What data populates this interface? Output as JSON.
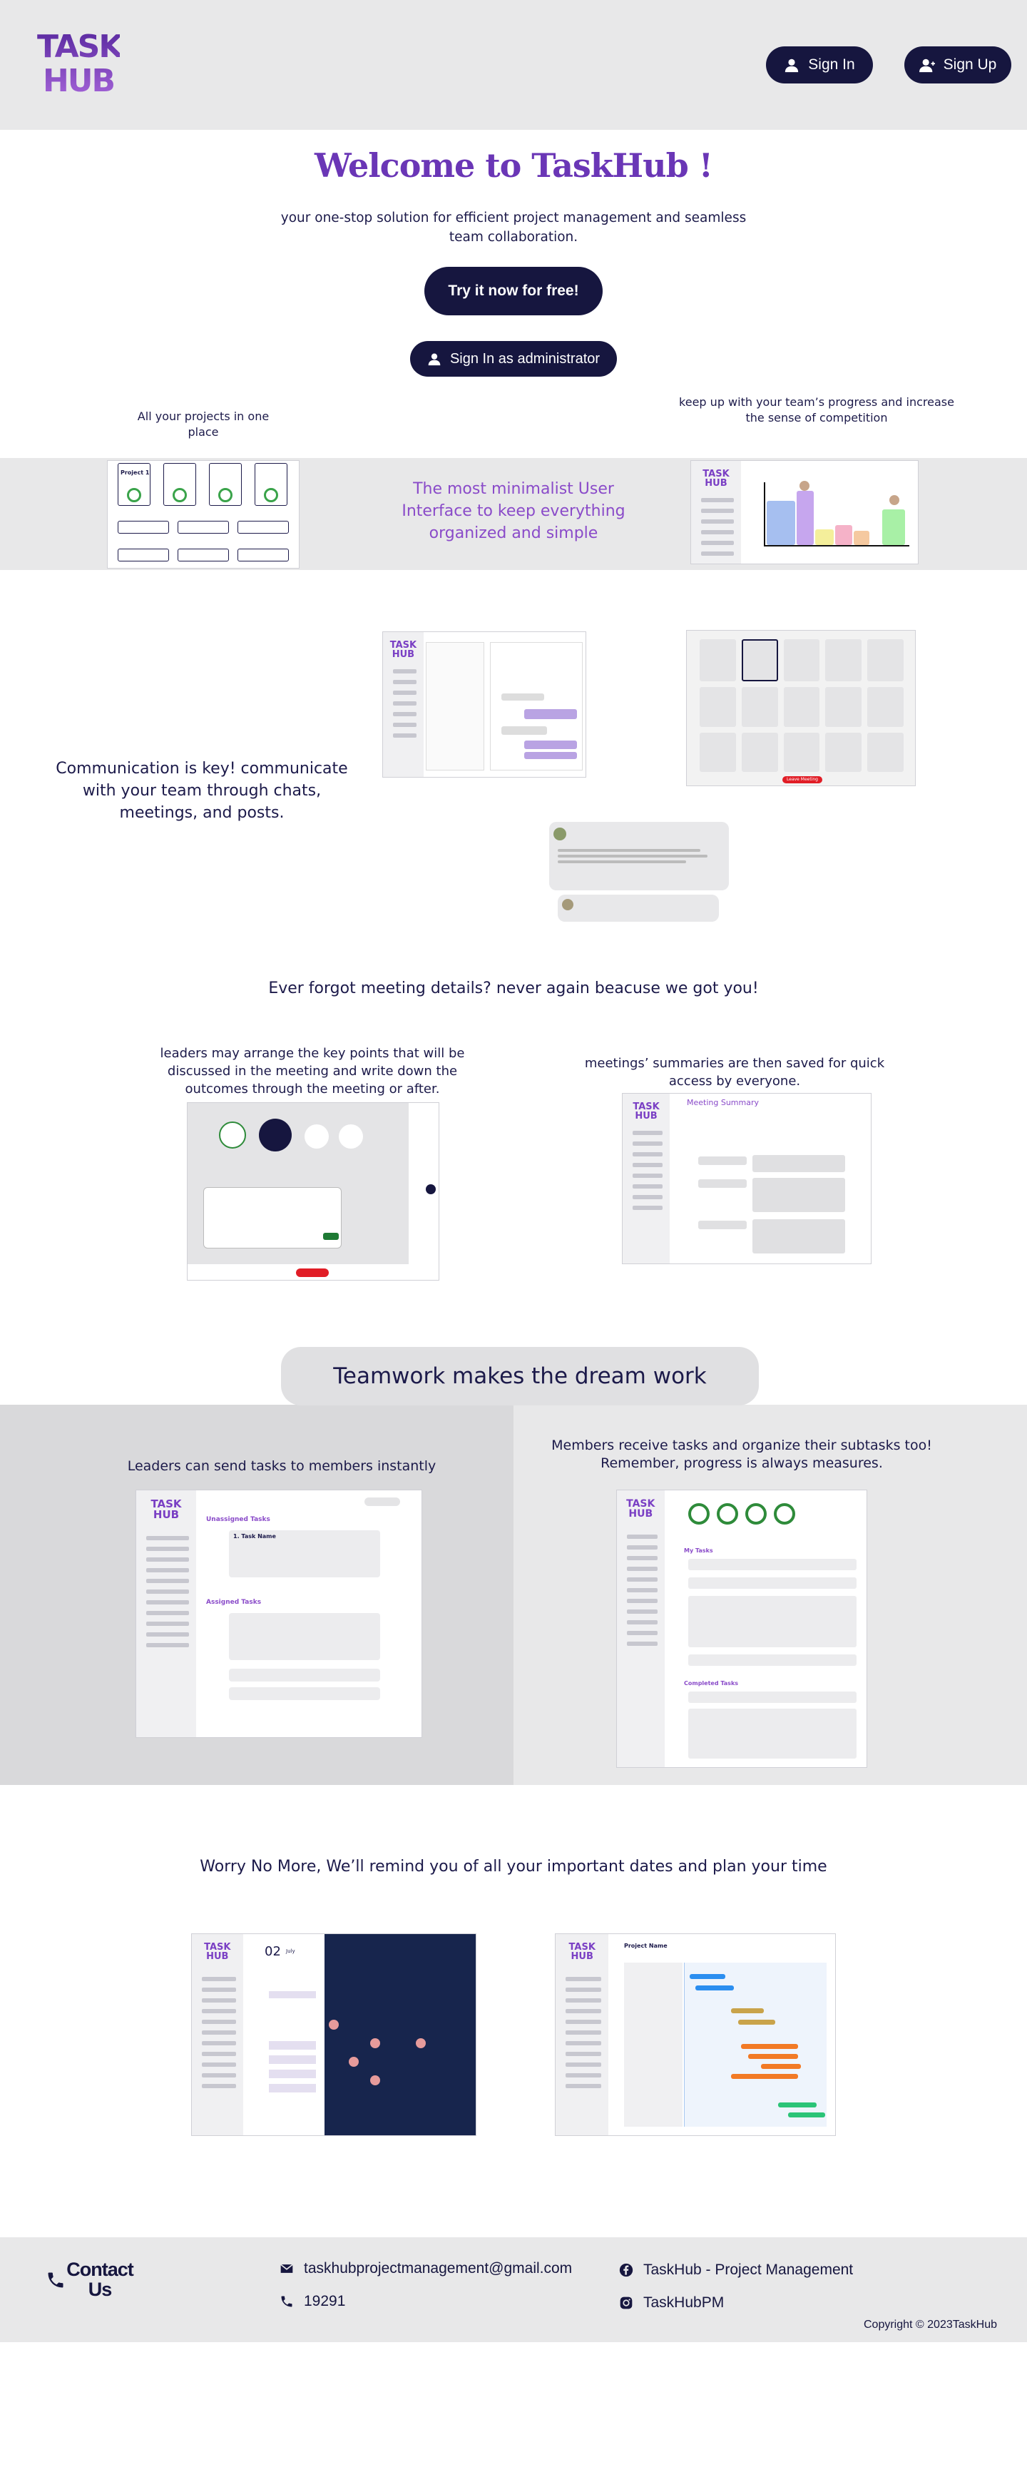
{
  "brand": {
    "logo_line1": "TASK",
    "logo_line2": "HUB"
  },
  "header": {
    "sign_in_label": "Sign In",
    "sign_up_label": "Sign Up"
  },
  "hero": {
    "title": "Welcome to TaskHub !",
    "subtitle": "your one-stop solution for efficient project management and seamless team collaboration.",
    "cta_label": "Try it now for free!",
    "admin_label": "Sign In as administrator"
  },
  "features": {
    "projects_caption": "All your projects in one place",
    "competition_caption": "keep up with your team’s progress and increase the sense of competition",
    "minimal_text": "The most minimalist User Interface to keep everything organized and simple",
    "communication_text": "Communication is key! communicate with your team through chats, meetings, and posts.",
    "meeting_heading": "Ever forgot meeting details? never again beacuse we got you!",
    "meeting_left_caption": "leaders may arrange the key points that will be discussed in the meeting and write down the outcomes through the meeting or after.",
    "meeting_right_caption": "meetings’ summaries are then saved for quick access by everyone.",
    "teamwork_heading": "Teamwork makes the dream work",
    "leaders_caption": "Leaders can send tasks to members instantly",
    "members_caption": "Members receive tasks and organize their subtasks too! Remember, progress is always measures.",
    "calendar_heading": "Worry No More, We’ll remind you of all your important dates and plan your time"
  },
  "mockups": {
    "project_card_label": "Project 1",
    "meeting_summary_title": "Meeting Summary",
    "unassigned_label": "Unassigned Tasks",
    "assigned_label": "Assigned Tasks",
    "task_label": "1. Task Name",
    "my_tasks_label": "My Tasks",
    "completed_label": "Completed Tasks",
    "calendar_day": "02",
    "calendar_month": "July",
    "gantt_title": "Project Name",
    "leave_meeting": "Leave Meeting"
  },
  "footer": {
    "contact_title": "Contact Us",
    "email": "taskhubprojectmanagement@gmail.com",
    "phone": "19291",
    "facebook": "TaskHub - Project Management",
    "instagram": "TaskHubPM",
    "copyright": "Copyright © 2023TaskHub"
  },
  "colors": {
    "primary": "#16163f",
    "accent": "#7a3fc4",
    "band": "#e8e8e9"
  }
}
